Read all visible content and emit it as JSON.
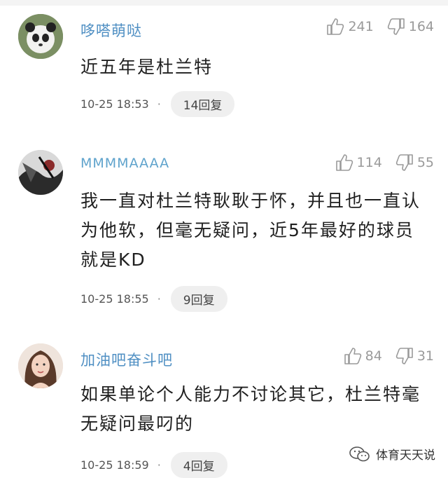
{
  "comments": [
    {
      "username": "哆嗒萌哒",
      "likes": "241",
      "dislikes": "164",
      "text": "近五年是杜兰特",
      "time": "10-25 18:53",
      "replies": "14回复"
    },
    {
      "username": "MMMMAAAA",
      "likes": "114",
      "dislikes": "55",
      "text": "我一直对杜兰特耿耿于怀，并且也一直认为他软，但毫无疑问，近5年最好的球员就是KD",
      "time": "10-25 18:55",
      "replies": "9回复"
    },
    {
      "username": "加油吧奋斗吧",
      "likes": "84",
      "dislikes": "31",
      "text": "如果单论个人能力不讨论其它，杜兰特毫无疑问最叼的",
      "time": "10-25 18:59",
      "replies": "4回复"
    }
  ],
  "watermark": "体育天天说"
}
